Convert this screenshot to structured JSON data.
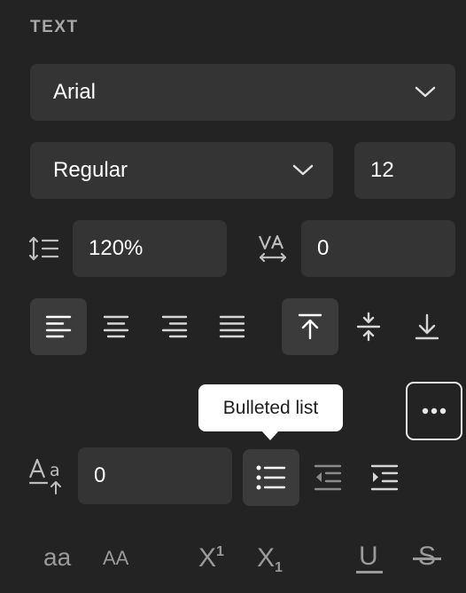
{
  "panel": {
    "section_title": "TEXT",
    "font_family": {
      "value": "Arial",
      "icon": "chevron-down-icon"
    },
    "font_style": {
      "value": "Regular",
      "icon": "chevron-down-icon"
    },
    "font_size": {
      "value": "12"
    },
    "line_height": {
      "icon": "line-height-icon",
      "value": "120%"
    },
    "letter_spacing": {
      "icon": "letter-spacing-icon",
      "value": "0"
    },
    "horizontal_align": {
      "buttons": [
        {
          "name": "align-left",
          "active": true
        },
        {
          "name": "align-center",
          "active": false
        },
        {
          "name": "align-right",
          "active": false
        },
        {
          "name": "align-justify",
          "active": false
        }
      ]
    },
    "vertical_align": {
      "buttons": [
        {
          "name": "align-top",
          "active": true
        },
        {
          "name": "align-middle",
          "active": false
        },
        {
          "name": "align-bottom",
          "active": false
        }
      ]
    },
    "tooltip": {
      "text": "Bulleted list"
    },
    "more_options": {
      "icon": "more-icon"
    },
    "paragraph_spacing": {
      "icon": "paragraph-spacing-icon",
      "value": "0"
    },
    "list_controls": [
      {
        "name": "bulleted-list",
        "active": true
      },
      {
        "name": "outdent",
        "active": false
      },
      {
        "name": "indent",
        "active": false
      }
    ],
    "case": {
      "lowercase": "aa",
      "uppercase": "AA"
    },
    "script": {
      "superscript_base": "X",
      "superscript_mark": "1",
      "subscript_base": "X",
      "subscript_mark": "1"
    },
    "decoration": {
      "underline": "U",
      "strikethrough": "S"
    },
    "colors": {
      "background": "#232323",
      "field": "#343434",
      "active": "#3b3b3b",
      "icon": "#d6d6d6",
      "muted": "#9a9a9a"
    }
  }
}
